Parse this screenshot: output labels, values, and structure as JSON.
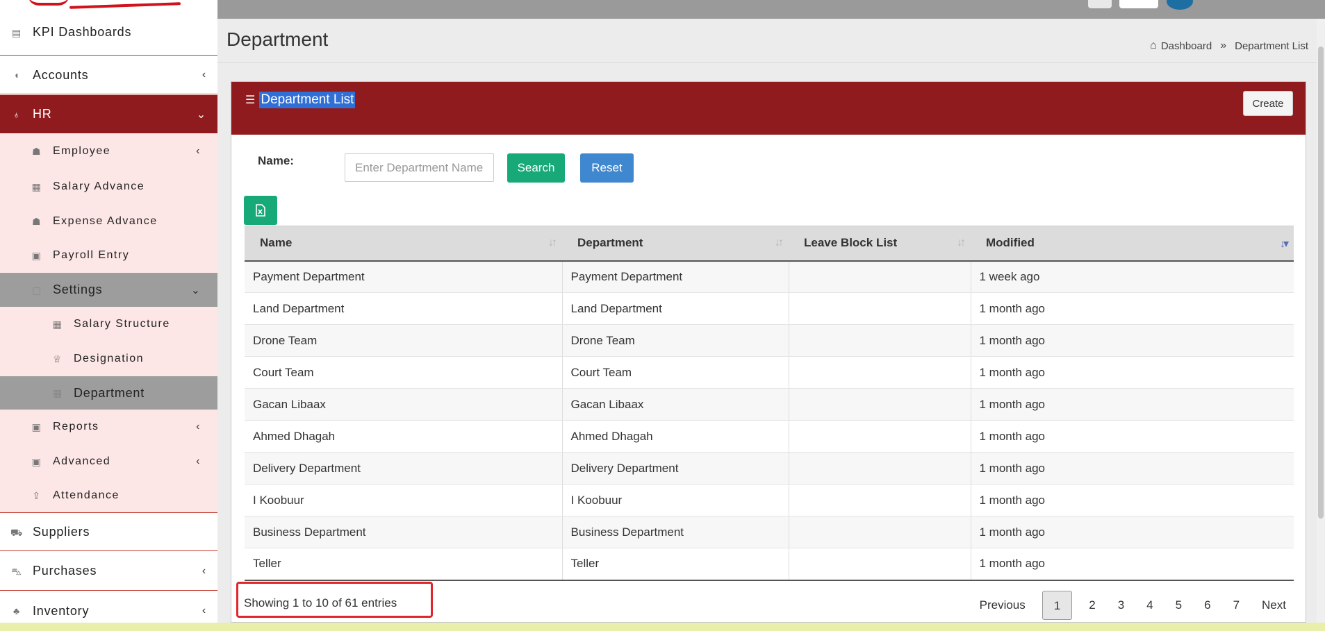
{
  "sidebar": {
    "items": [
      {
        "label": "KPI Dashboards",
        "icon": "dashboard-icon"
      },
      {
        "label": "Accounts",
        "icon": "piggy-bank-icon"
      },
      {
        "label": "HR",
        "icon": "award-icon"
      },
      {
        "label": "Employee",
        "icon": "user-edit-icon"
      },
      {
        "label": "Salary Advance",
        "icon": "table-icon"
      },
      {
        "label": "Expense Advance",
        "icon": "user-icon"
      },
      {
        "label": "Payroll Entry",
        "icon": "id-card-icon"
      },
      {
        "label": "Settings",
        "icon": "gear-icon"
      },
      {
        "label": "Salary Structure",
        "icon": "table-icon"
      },
      {
        "label": "Designation",
        "icon": "trophy-icon"
      },
      {
        "label": "Department",
        "icon": "table-icon"
      },
      {
        "label": "Reports",
        "icon": "report-icon"
      },
      {
        "label": "Advanced",
        "icon": "report-icon"
      },
      {
        "label": "Attendance",
        "icon": "upload-icon"
      },
      {
        "label": "Suppliers",
        "icon": "truck-icon"
      },
      {
        "label": "Purchases",
        "icon": "cart-icon"
      },
      {
        "label": "Inventory",
        "icon": "sitemap-icon"
      }
    ]
  },
  "page": {
    "title": "Department",
    "breadcrumb": {
      "home": "Dashboard",
      "separator": "»",
      "current": "Department List"
    }
  },
  "card": {
    "title": "Department List",
    "create_label": "Create"
  },
  "filter": {
    "name_label": "Name:",
    "name_placeholder": "Enter Department Name",
    "search_label": "Search",
    "reset_label": "Reset"
  },
  "table": {
    "columns": [
      "Name",
      "Department",
      "Leave Block List",
      "Modified"
    ],
    "rows": [
      [
        "Payment Department",
        "Payment Department",
        "",
        "1 week ago"
      ],
      [
        "Land Department",
        "Land Department",
        "",
        "1 month ago"
      ],
      [
        "Drone Team",
        "Drone Team",
        "",
        "1 month ago"
      ],
      [
        "Court Team",
        "Court Team",
        "",
        "1 month ago"
      ],
      [
        "Gacan Libaax",
        "Gacan Libaax",
        "",
        "1 month ago"
      ],
      [
        "Ahmed Dhagah",
        "Ahmed Dhagah",
        "",
        "1 month ago"
      ],
      [
        "Delivery Department",
        "Delivery Department",
        "",
        "1 month ago"
      ],
      [
        "I Koobuur",
        "I Koobuur",
        "",
        "1 month ago"
      ],
      [
        "Business Department",
        "Business Department",
        "",
        "1 month ago"
      ],
      [
        "Teller",
        "Teller",
        "",
        "1 month ago"
      ]
    ]
  },
  "footer": {
    "info": "Showing 1 to 10 of 61 entries",
    "pagination": {
      "previous": "Previous",
      "pages": [
        "1",
        "2",
        "3",
        "4",
        "5",
        "6",
        "7"
      ],
      "current": "1",
      "next": "Next"
    }
  },
  "colors": {
    "hr_active": "#8f1b1e",
    "card_header": "#8f1b1e",
    "search_btn": "#18a978",
    "reset_btn": "#3f88cf",
    "submenu_bg": "#fde6e6",
    "highlight_box": "#e0262b"
  }
}
